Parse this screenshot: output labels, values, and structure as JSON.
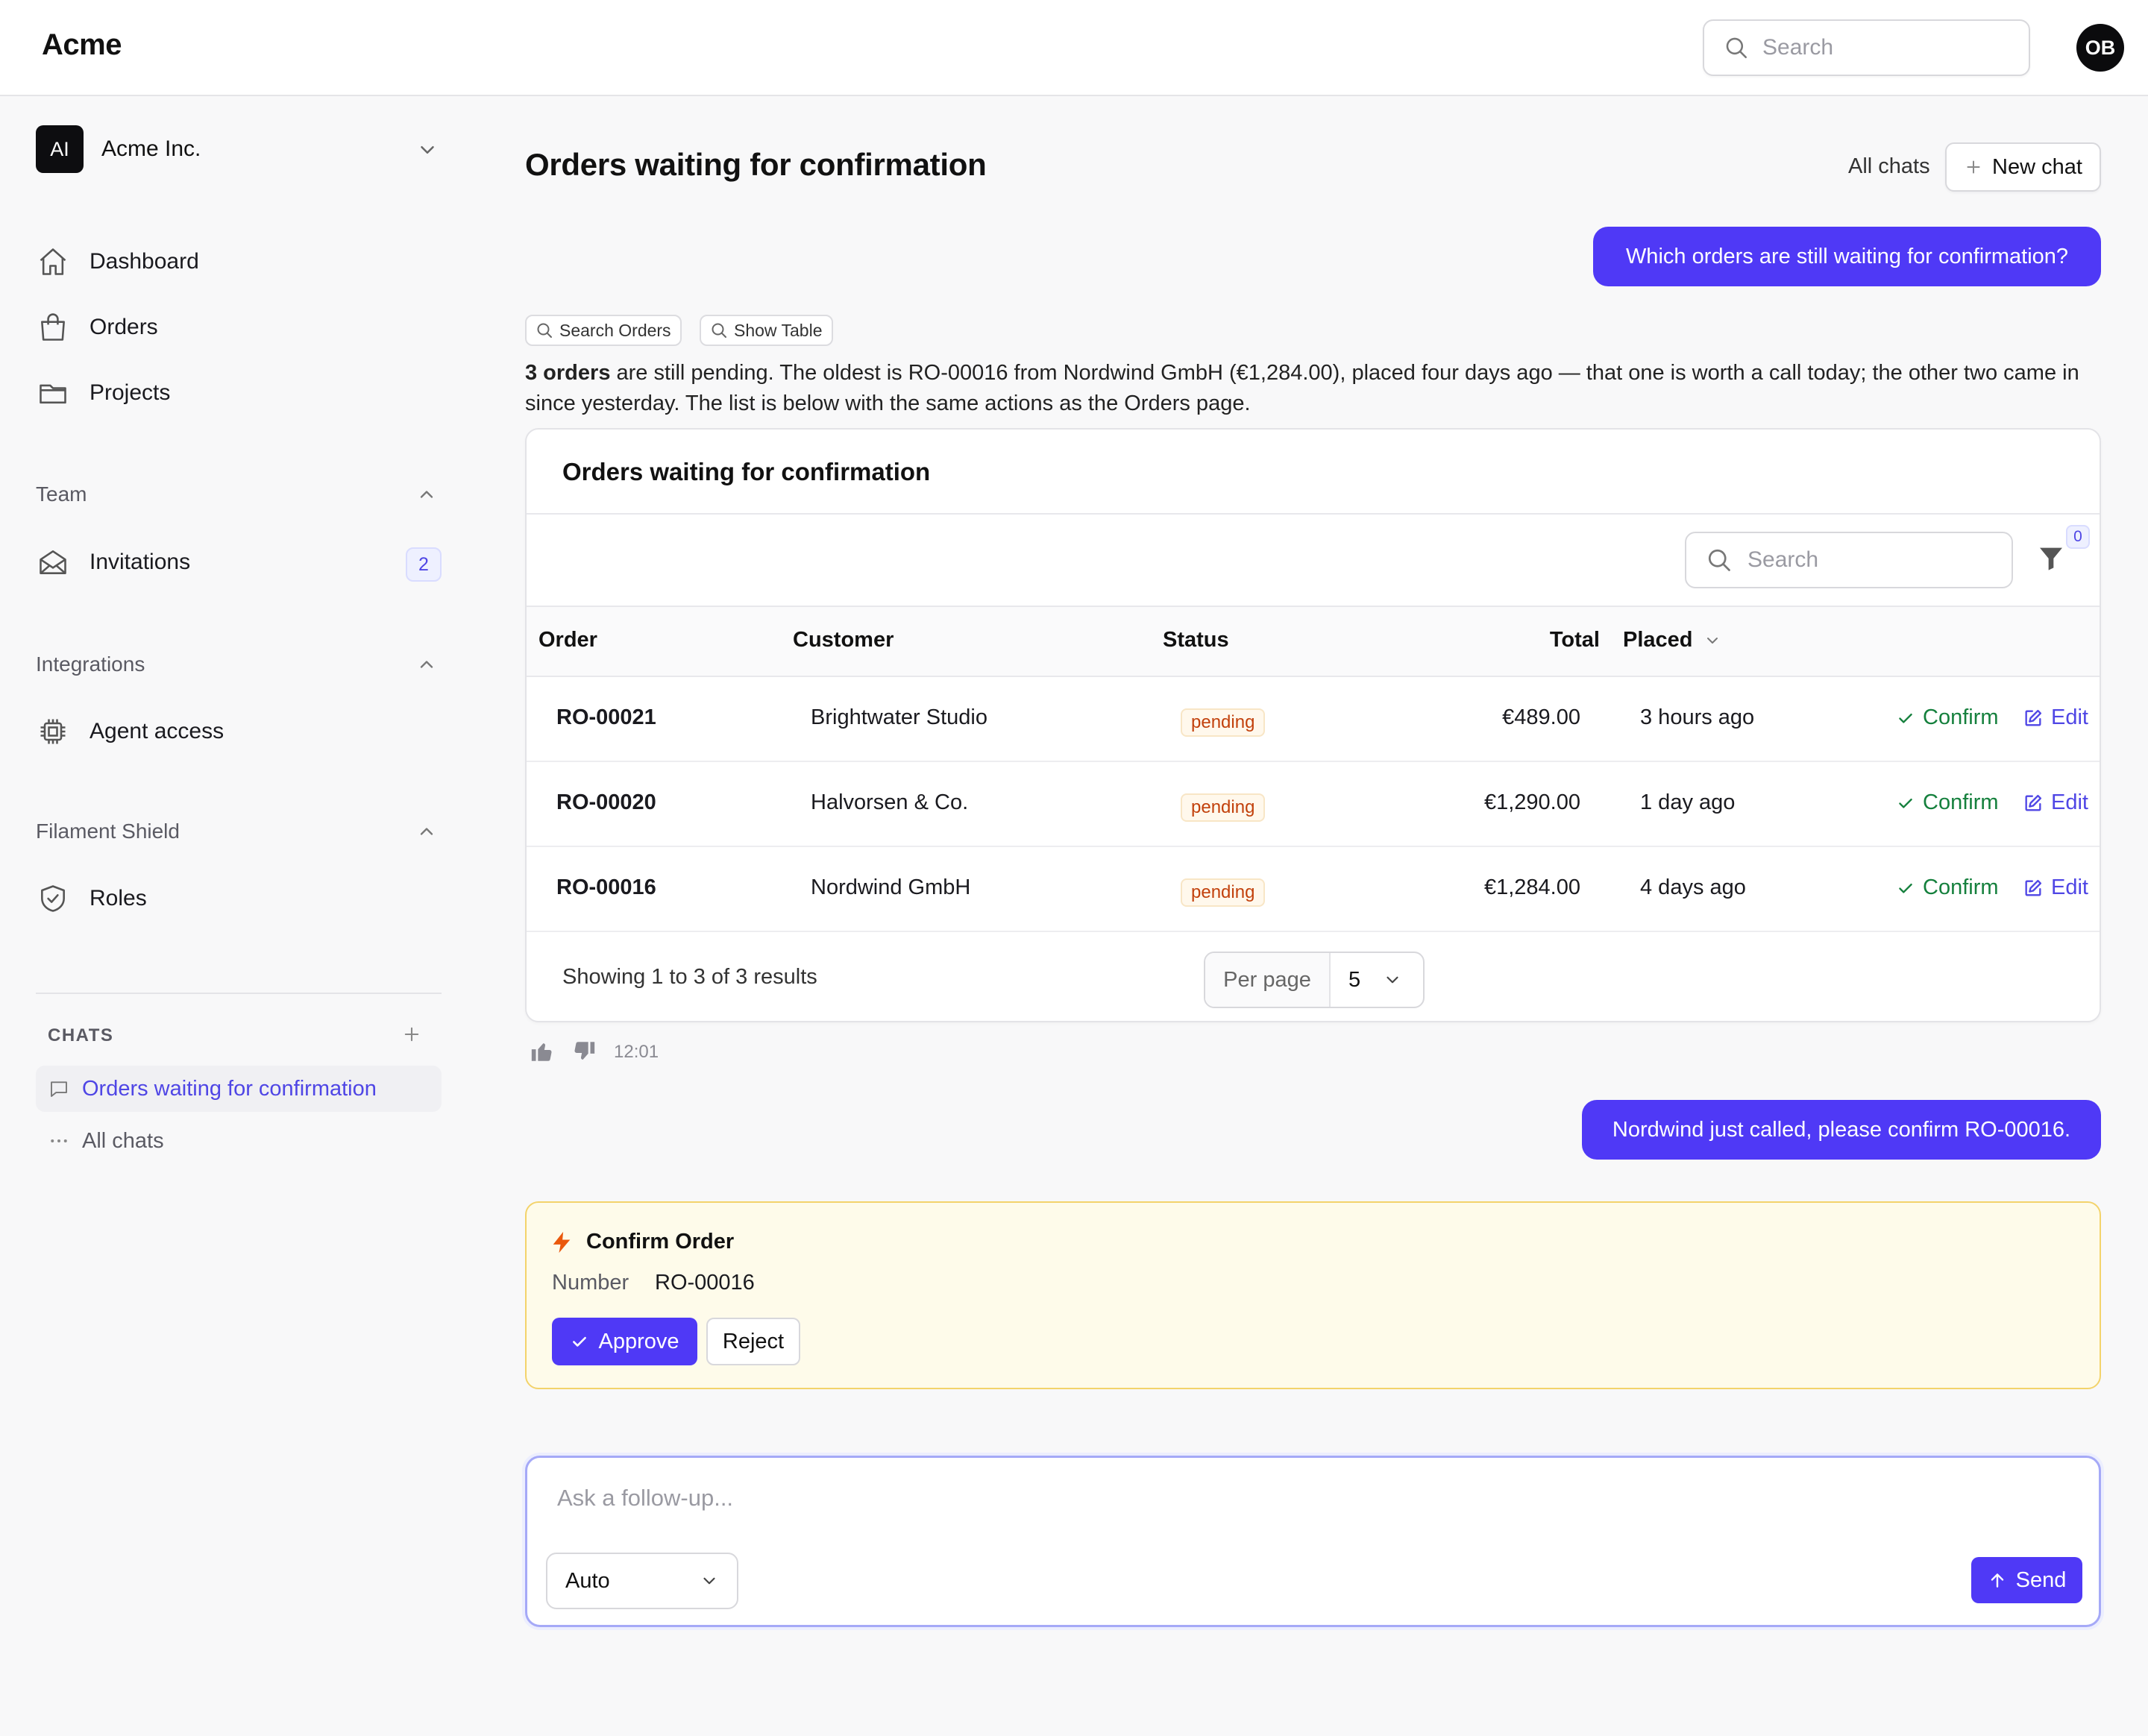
{
  "header": {
    "brand": "Acme",
    "search_placeholder": "Search",
    "user_initials": "OB"
  },
  "sidebar": {
    "tenant": {
      "initials": "AI",
      "name": "Acme Inc."
    },
    "nav": [
      {
        "label": "Dashboard",
        "icon": "home-icon"
      },
      {
        "label": "Orders",
        "icon": "shopping-bag-icon"
      },
      {
        "label": "Projects",
        "icon": "folder-icon"
      }
    ],
    "groups": [
      {
        "title": "Team",
        "items": [
          {
            "label": "Invitations",
            "icon": "envelope-open-icon",
            "badge": "2"
          }
        ]
      },
      {
        "title": "Integrations",
        "items": [
          {
            "label": "Agent access",
            "icon": "cpu-chip-icon"
          }
        ]
      },
      {
        "title": "Filament Shield",
        "items": [
          {
            "label": "Roles",
            "icon": "shield-check-icon"
          }
        ]
      }
    ],
    "chats": {
      "label": "CHATS",
      "items": [
        {
          "label": "Orders waiting for confirmation",
          "active": true
        },
        {
          "label": "All chats",
          "active": false
        }
      ]
    }
  },
  "main": {
    "title": "Orders waiting for confirmation",
    "all_chats": "All chats",
    "new_chat": "New chat",
    "messages": {
      "user_1": "Which orders are still waiting for confirmation?",
      "tools": [
        "Search Orders",
        "Show Table"
      ],
      "assistant_bold": "3 orders",
      "assistant_text": " are still pending. The oldest is RO-00016 from Nordwind GmbH (€1,284.00), placed four days ago — that one is worth a call today; the other two came in since yesterday. The list is below with the same actions as the Orders page.",
      "timestamp": "12:01",
      "user_2": "Nordwind just called, please confirm RO-00016."
    },
    "table": {
      "title": "Orders waiting for confirmation",
      "search_placeholder": "Search",
      "filter_count": "0",
      "columns": [
        "Order",
        "Customer",
        "Status",
        "Total",
        "Placed"
      ],
      "rows": [
        {
          "order": "RO-00021",
          "customer": "Brightwater Studio",
          "status": "pending",
          "total": "€489.00",
          "placed": "3 hours ago"
        },
        {
          "order": "RO-00020",
          "customer": "Halvorsen & Co.",
          "status": "pending",
          "total": "€1,290.00",
          "placed": "1 day ago"
        },
        {
          "order": "RO-00016",
          "customer": "Nordwind GmbH",
          "status": "pending",
          "total": "€1,284.00",
          "placed": "4 days ago"
        }
      ],
      "row_actions": {
        "confirm": "Confirm",
        "edit": "Edit"
      },
      "pagination_text": "Showing 1 to 3 of 3 results",
      "per_page_label": "Per page",
      "per_page_value": "5"
    },
    "approval": {
      "title": "Confirm Order",
      "field_label": "Number",
      "field_value": "RO-00016",
      "approve": "Approve",
      "reject": "Reject"
    },
    "composer": {
      "placeholder": "Ask a follow-up...",
      "model": "Auto",
      "send": "Send"
    }
  },
  "colors": {
    "accent": "#4f39f6",
    "confirm_green": "#15803d",
    "pending_orange": "#c2410c",
    "approval_bg": "#fefbea",
    "approval_border": "#f3d36b"
  }
}
